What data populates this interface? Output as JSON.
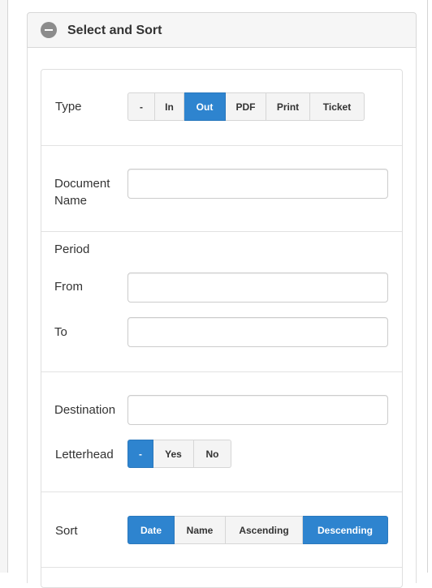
{
  "header": {
    "title": "Select and Sort"
  },
  "type": {
    "label": "Type",
    "options": [
      "-",
      "In",
      "Out",
      "PDF",
      "Print",
      "Ticket"
    ],
    "selected": "Out"
  },
  "document_name": {
    "label_line1": "Document",
    "label_line2": "Name",
    "value": ""
  },
  "period": {
    "label": "Period",
    "from_label": "From",
    "to_label": "To",
    "from_value": "",
    "to_value": ""
  },
  "destination": {
    "label": "Destination",
    "value": ""
  },
  "letterhead": {
    "label": "Letterhead",
    "options": [
      "-",
      "Yes",
      "No"
    ],
    "selected": "-"
  },
  "sort": {
    "label": "Sort",
    "options": [
      "Date",
      "Name",
      "Ascending",
      "Descending"
    ],
    "selected": [
      "Date",
      "Descending"
    ]
  },
  "colors": {
    "accent": "#2e84cf"
  }
}
